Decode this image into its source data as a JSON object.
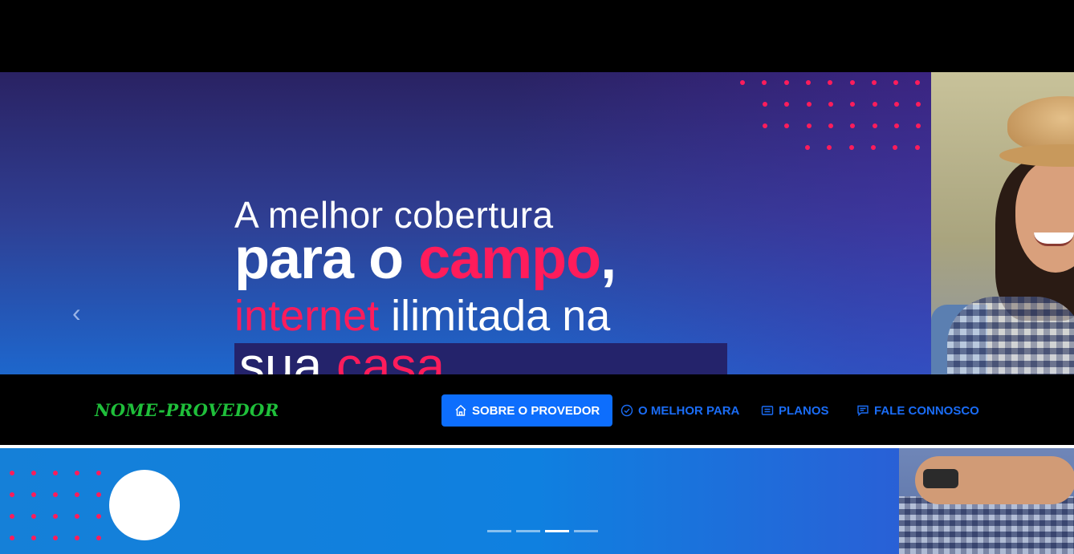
{
  "hero": {
    "line1": "A melhor cobertura",
    "line2_a": "para o ",
    "line2_b": "campo",
    "line2_c": ",",
    "line3_a": "internet",
    "line3_b": " ilimitada na",
    "line4_a": "sua ",
    "line4_b": "casa",
    "prev_arrow": "‹"
  },
  "navbar": {
    "brand": "NOME-PROVEDOR",
    "items": [
      {
        "label": "SOBRE O PROVEDOR",
        "icon": "home-icon",
        "active": true
      },
      {
        "label": "O MELHOR PARA",
        "icon": "check-circle-icon",
        "active": false
      },
      {
        "label": "PLANOS",
        "icon": "card-list-icon",
        "active": false
      },
      {
        "label": "FALE CONNOSCO",
        "icon": "chat-icon",
        "active": false
      }
    ]
  },
  "carousel": {
    "slide_count": 4,
    "active_index": 2
  },
  "colors": {
    "accent_pink": "#ff1c5b",
    "nav_blue": "#0d6efd",
    "brand_green": "#1fbf3a"
  }
}
